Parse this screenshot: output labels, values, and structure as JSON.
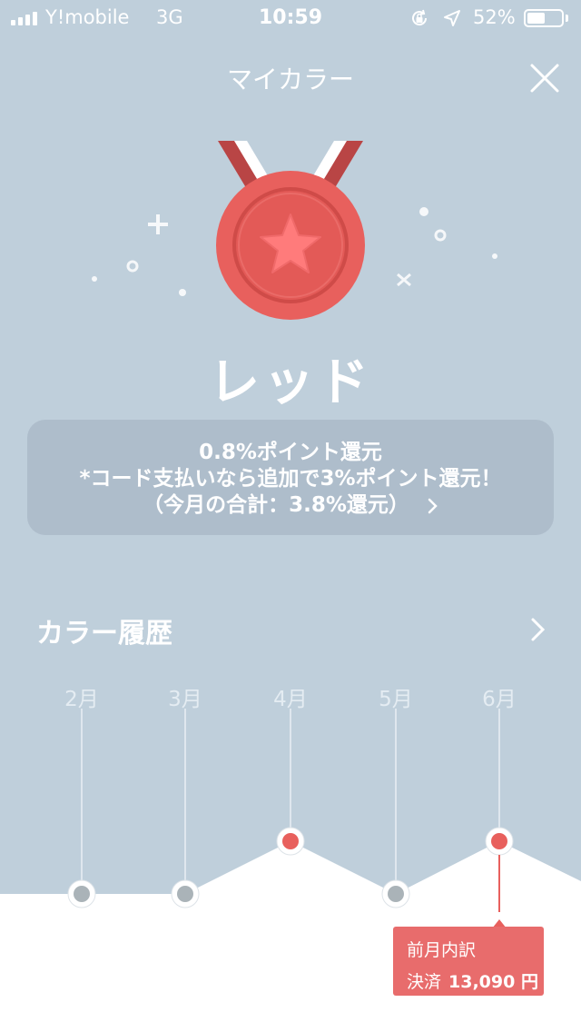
{
  "status_bar": {
    "carrier": "Y!mobile",
    "network": "3G",
    "time": "10:59",
    "battery_percent": "52%",
    "battery_level": 0.52,
    "icons": [
      "signal-icon",
      "rotation-lock-icon",
      "location-icon",
      "battery-icon"
    ]
  },
  "header": {
    "title": "マイカラー",
    "close_icon": "close-icon"
  },
  "medal": {
    "color_name": "レッド",
    "accent": "#e8605d",
    "icon": "medal-star-icon"
  },
  "info": {
    "line1": "0.8%ポイント還元",
    "line2": "*コード支払いなら追加で3%ポイント還元！",
    "line3": "（今月の合計：3.8%還元）"
  },
  "history": {
    "title": "カラー履歴",
    "months": [
      {
        "label": "2月",
        "status": "gray"
      },
      {
        "label": "3月",
        "status": "gray"
      },
      {
        "label": "4月",
        "status": "red"
      },
      {
        "label": "5月",
        "status": "gray"
      },
      {
        "label": "6月",
        "status": "red"
      }
    ],
    "tooltip": {
      "title": "前月内訳",
      "label": "決済",
      "amount": "13,090 円"
    }
  },
  "colors": {
    "background": "#bfcfdb",
    "red": "#e8605d",
    "gray": "#aab3b8"
  }
}
